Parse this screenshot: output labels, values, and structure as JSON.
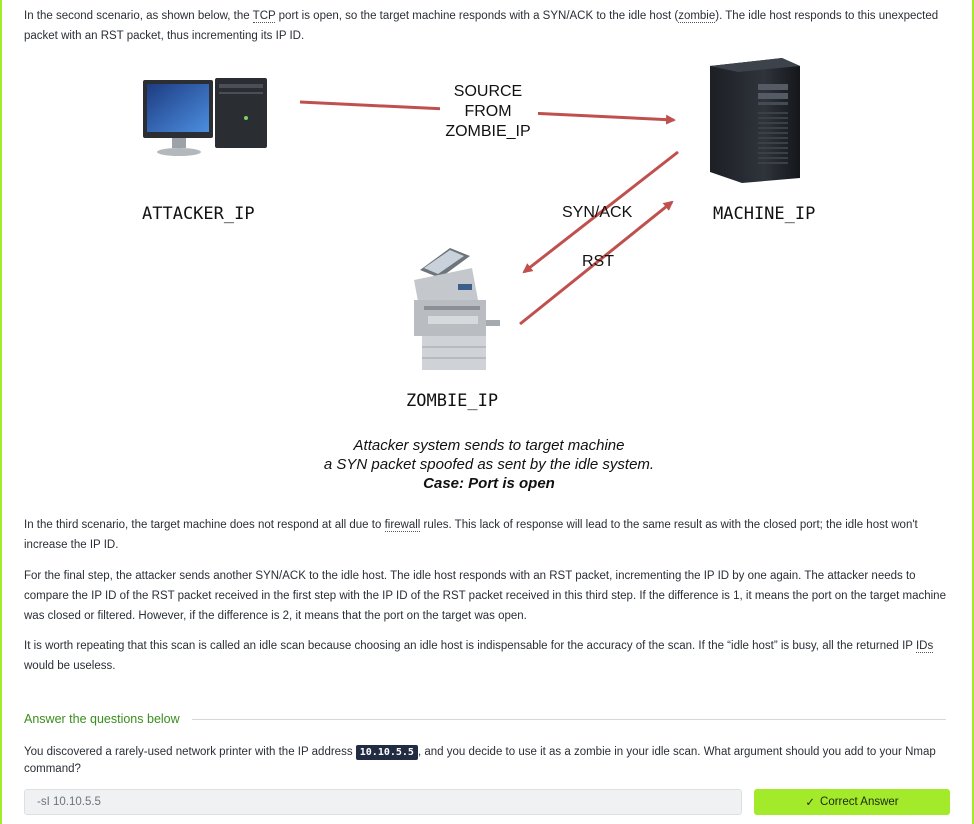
{
  "paragraphs": {
    "p1": {
      "a": "In the second scenario, as shown below, the ",
      "tcp": "TCP",
      "b": " port is open, so the target machine responds with a SYN/ACK to the idle host (",
      "zombie": "zombie",
      "c": "). The idle host responds to this unexpected packet with an RST packet, thus incrementing its IP ID."
    },
    "p2": {
      "a": "In the third scenario, the target machine does not respond at all due to ",
      "firewall": "firewall",
      "b": " rules. This lack of response will lead to the same result as with the closed port; the idle host won't increase the IP ID."
    },
    "p3": "For the final step, the attacker sends another SYN/ACK to the idle host. The idle host responds with an RST packet, incrementing the IP ID by one again. The attacker needs to compare the IP ID of the RST packet received in the first step with the IP ID of the RST packet received in this third step. If the difference is 1, it means the port on the target machine was closed or filtered. However, if the difference is 2, it means that the port on the target was open.",
    "p4": {
      "a": "It is worth repeating that this scan is called an idle scan because choosing an idle host is indispensable for the accuracy of the scan. If the “idle host” is busy, all the returned IP ",
      "ids": "IDs",
      "b": " would be useless."
    }
  },
  "diagram": {
    "attacker_label": "ATTACKER_IP",
    "machine_label": "MACHINE_IP",
    "zombie_label": "ZOMBIE_IP",
    "source_line1": "SOURCE",
    "source_line2": "FROM",
    "source_line3": "ZOMBIE_IP",
    "synack_label": "SYN/ACK",
    "rst_label": "RST",
    "caption_line1": "Attacker system sends to target machine",
    "caption_line2": "a SYN packet spoofed as sent by the idle system.",
    "caption_line3": "Case: Port is open",
    "arrow_color": "#c0504d"
  },
  "qa": {
    "section_title": "Answer the questions below",
    "question_a": "You discovered a rarely-used network printer with the IP address ",
    "question_ip": "10.10.5.5",
    "question_b": ", and you decide to use it as a zombie in your idle scan. What argument should you add to your Nmap command?",
    "answer_value": "-sI 10.10.5.5",
    "button_label": "Correct Answer",
    "button_icon": "checkmark-icon"
  },
  "colors": {
    "accent": "#a3ea2a",
    "section_green": "#3a8e1c",
    "code_bg": "#212c42"
  }
}
